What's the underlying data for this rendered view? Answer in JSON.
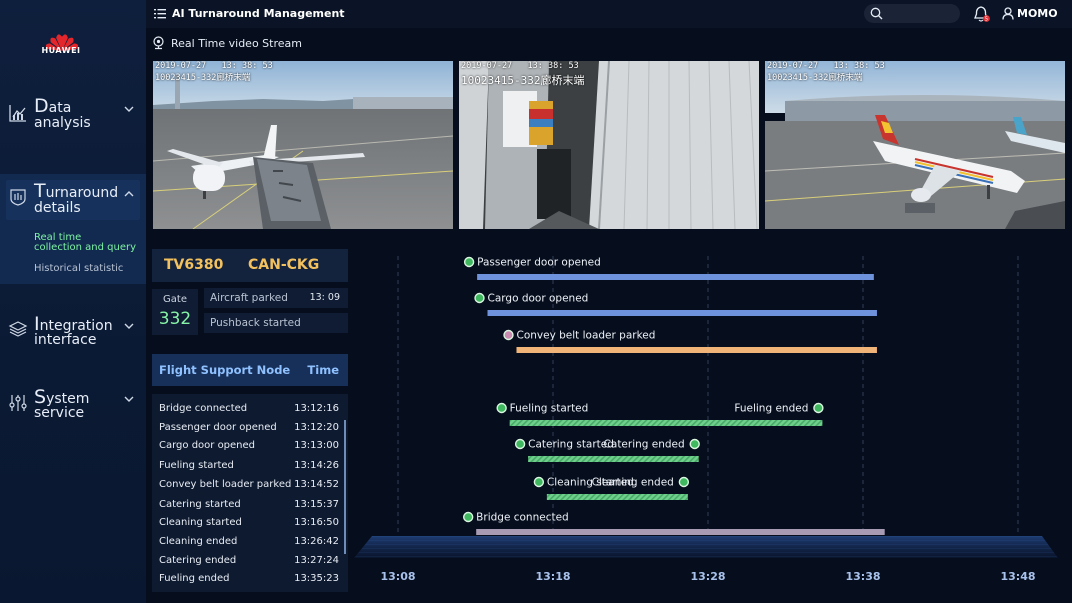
{
  "brand": {
    "name": "HUAWEI"
  },
  "sidebar": {
    "items": [
      {
        "cap": "D",
        "rest1": "ata",
        "line2": "analysis"
      },
      {
        "cap": "T",
        "rest1": "urnaround",
        "line2": "details"
      },
      {
        "cap": "I",
        "rest1": "ntegration",
        "line2": "interface"
      },
      {
        "cap": "S",
        "rest1": "ystem",
        "line2": "service"
      }
    ],
    "sub_items": [
      {
        "line1": "Real time",
        "line2": "collection and query"
      },
      {
        "line1": "Historical statistic"
      }
    ]
  },
  "header": {
    "title": "AI Turnaround Management",
    "user": "MOMO",
    "notification_count": "5"
  },
  "video": {
    "title": "Real Time video Stream",
    "cameras": [
      {
        "timestamp": "2019-07-27   13: 38: 53",
        "label": "10023415-332廊桥末端"
      },
      {
        "timestamp": "2019-07-27   13: 38: 53",
        "label": "10023415-332廊桥末端"
      },
      {
        "timestamp": "2019-07-27   13: 38: 53",
        "label": "10023415-332廊桥末端"
      }
    ]
  },
  "flight": {
    "number": "TV6380",
    "route": "CAN-CKG",
    "gate_label": "Gate",
    "gate": "332",
    "status": [
      {
        "label": "Aircraft parked",
        "time": "13: 09"
      },
      {
        "label": "Pushback started",
        "time": ""
      }
    ]
  },
  "support": {
    "title": "Flight Support Node",
    "time_header": "Time",
    "rows": [
      {
        "name": "Bridge connected",
        "time": "13:12:16"
      },
      {
        "name": "Passenger door opened",
        "time": "13:12:20"
      },
      {
        "name": "Cargo door opened",
        "time": "13:13:00"
      },
      {
        "name": "Fueling started",
        "time": "13:14:26"
      },
      {
        "name": "Convey belt loader parked",
        "time": "13:14:52"
      },
      {
        "name": "Catering started",
        "time": "13:15:37"
      },
      {
        "name": "Cleaning started",
        "time": "13:16:50"
      },
      {
        "name": "Cleaning ended",
        "time": "13:26:42"
      },
      {
        "name": "Catering ended",
        "time": "13:27:24"
      },
      {
        "name": "Fueling ended",
        "time": "13:35:23"
      }
    ]
  },
  "timeline": {
    "axis_ticks": [
      "13:08",
      "13:18",
      "13:28",
      "13:38",
      "13:48"
    ],
    "axis_minutes": [
      0,
      10,
      20,
      30,
      40
    ],
    "bars": [
      {
        "start_label": "Passenger door opened",
        "end_label": "",
        "start_min": 4.33,
        "end_min": 30.7,
        "color": "#6f92dc",
        "dot": "#3fb85f",
        "striped": false
      },
      {
        "start_label": "Cargo door opened",
        "end_label": "",
        "start_min": 5.0,
        "end_min": 30.9,
        "color": "#6f92dc",
        "dot": "#3fb85f",
        "striped": false
      },
      {
        "start_label": "Convey belt loader parked",
        "end_label": "",
        "start_min": 6.87,
        "end_min": 30.9,
        "color": "#f0b478",
        "dot": "#c98bb0",
        "striped": false
      },
      {
        "start_label": "Fueling started",
        "end_label": "Fueling ended",
        "start_min": 6.43,
        "end_min": 27.38,
        "color": "#6ed08a",
        "dot": "#3fb85f",
        "striped": true
      },
      {
        "start_label": "Catering started",
        "end_label": "Catering ended",
        "start_min": 7.62,
        "end_min": 19.4,
        "color": "#6ed08a",
        "dot": "#3fb85f",
        "striped": true
      },
      {
        "start_label": "Cleaning started",
        "end_label": "Cleaning ended",
        "start_min": 8.83,
        "end_min": 18.7,
        "color": "#6ed08a",
        "dot": "#3fb85f",
        "striped": true
      },
      {
        "start_label": "Bridge connected",
        "end_label": "",
        "start_min": 4.27,
        "end_min": 31.4,
        "color": "#a69bb3",
        "dot": "#3fb85f",
        "striped": false
      }
    ]
  }
}
